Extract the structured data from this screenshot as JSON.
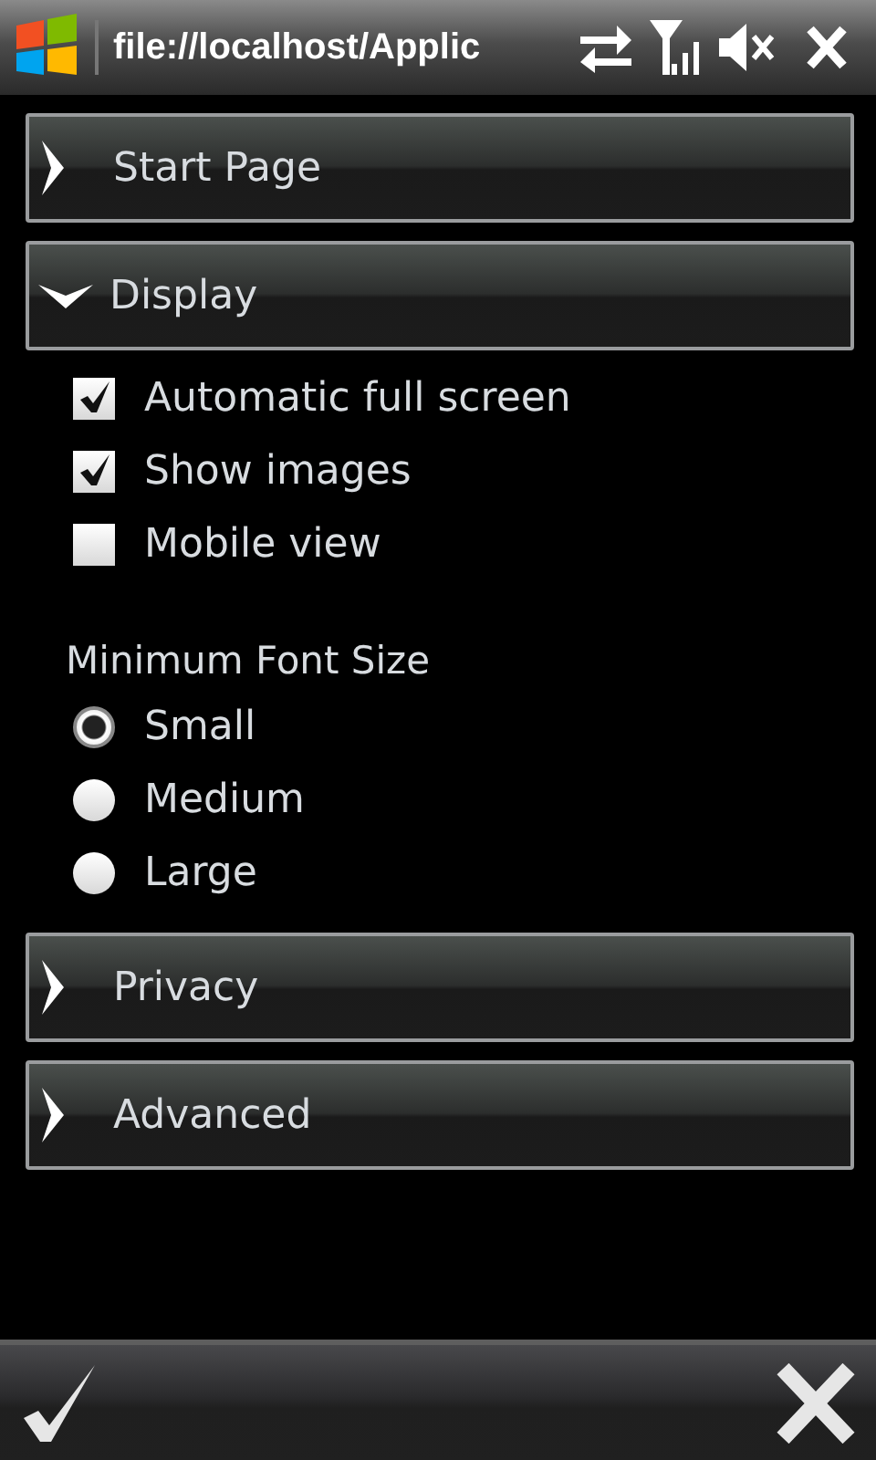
{
  "status_bar": {
    "title": "file://localhost/Applic"
  },
  "sections": [
    {
      "label": "Start Page",
      "expanded": false
    },
    {
      "label": "Display",
      "expanded": true,
      "checkboxes": [
        {
          "label": "Automatic full screen",
          "checked": true
        },
        {
          "label": "Show images",
          "checked": true
        },
        {
          "label": "Mobile view",
          "checked": false
        }
      ],
      "font_size": {
        "label": "Minimum Font Size",
        "options": [
          {
            "label": "Small",
            "selected": true
          },
          {
            "label": "Medium",
            "selected": false
          },
          {
            "label": "Large",
            "selected": false
          }
        ]
      }
    },
    {
      "label": "Privacy",
      "expanded": false
    },
    {
      "label": "Advanced",
      "expanded": false
    }
  ]
}
